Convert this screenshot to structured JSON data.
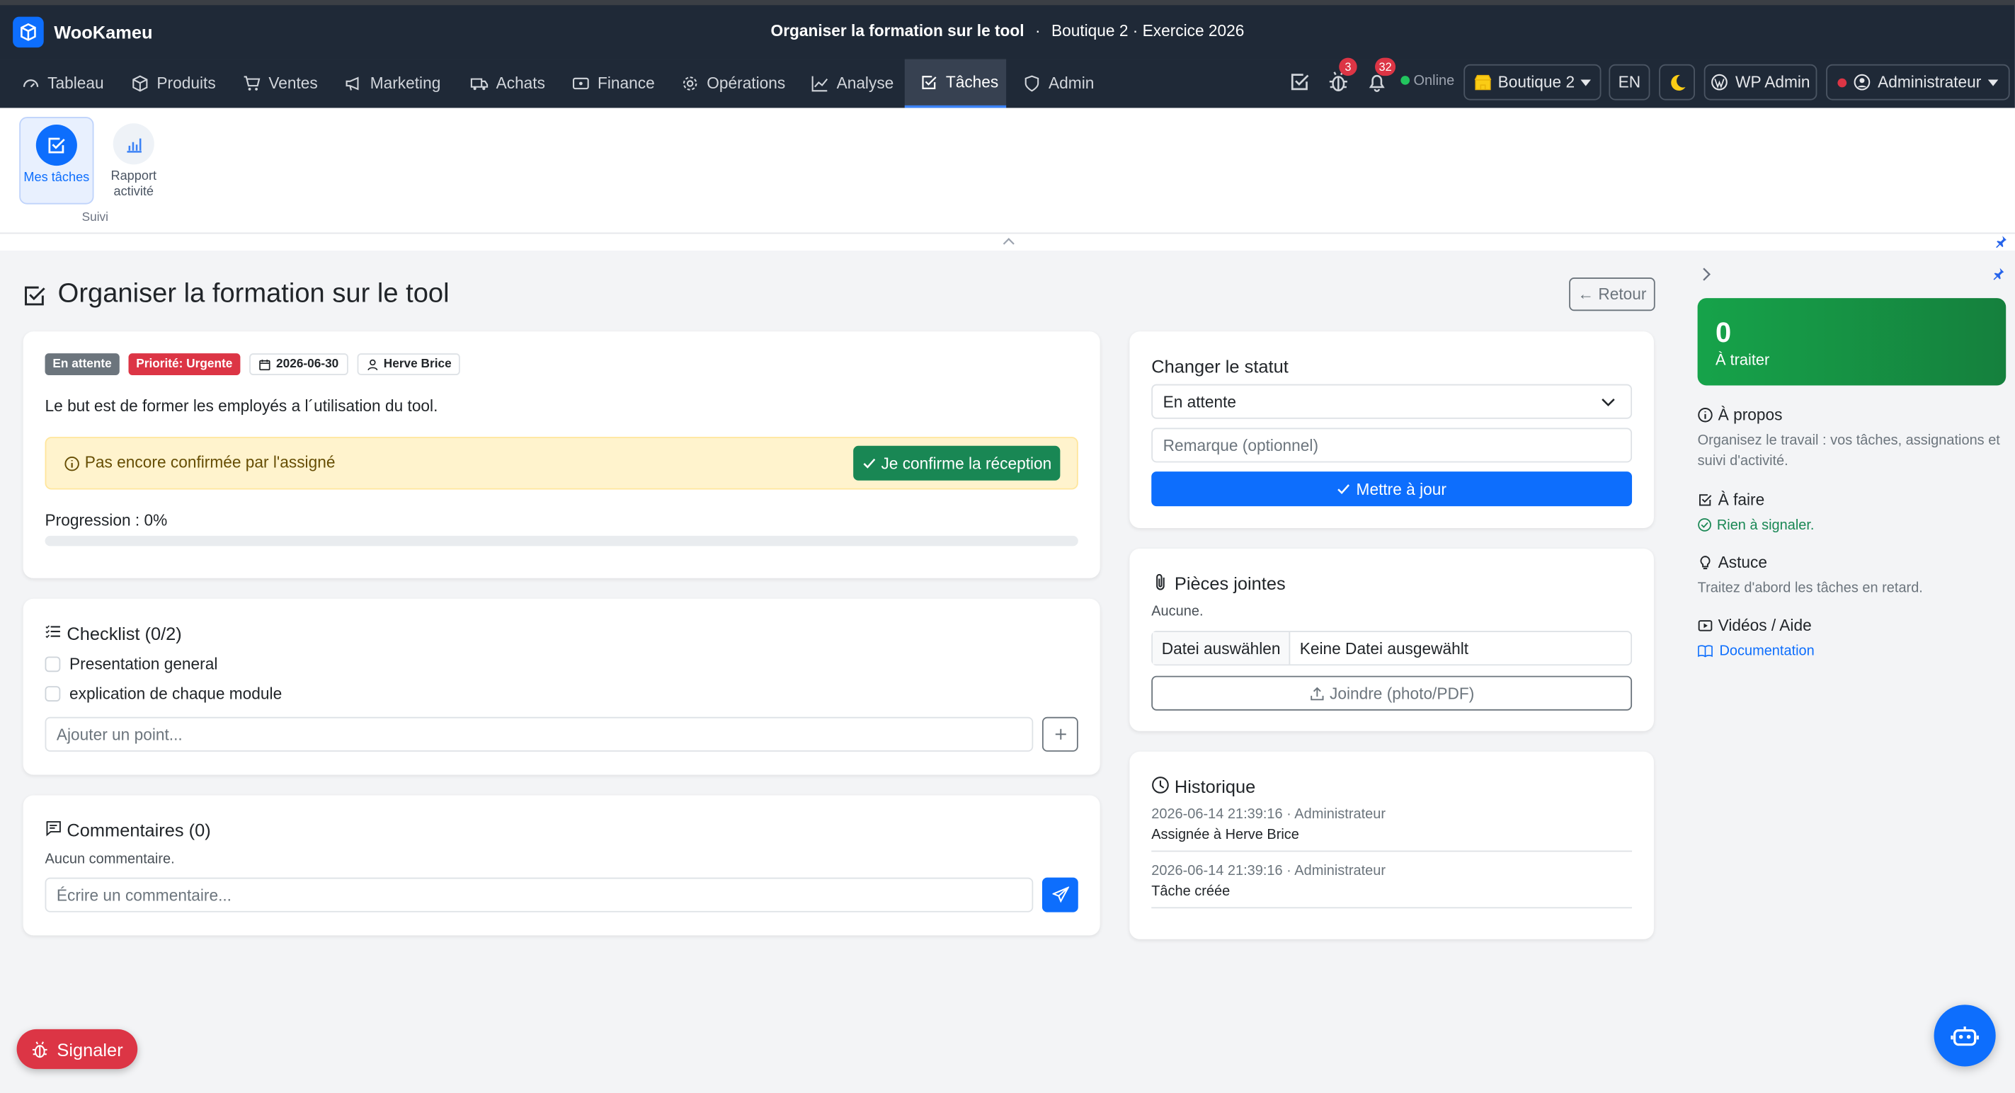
{
  "app": {
    "name": "WooKameu"
  },
  "context": {
    "task_title": "Organiser la formation sur le tool",
    "separator": "·",
    "shop_year": "Boutique 2 · Exercice 2026"
  },
  "nav": [
    {
      "label": "Tableau",
      "icon": "dashboard-icon"
    },
    {
      "label": "Produits",
      "icon": "box-icon"
    },
    {
      "label": "Ventes",
      "icon": "cart-icon"
    },
    {
      "label": "Marketing",
      "icon": "megaphone-icon"
    },
    {
      "label": "Achats",
      "icon": "truck-icon"
    },
    {
      "label": "Finance",
      "icon": "wallet-icon"
    },
    {
      "label": "Opérations",
      "icon": "gear-icon"
    },
    {
      "label": "Analyse",
      "icon": "chart-line-icon"
    },
    {
      "label": "Tâches",
      "icon": "check-square-icon",
      "active": true
    },
    {
      "label": "Admin",
      "icon": "shield-icon"
    }
  ],
  "nav_right": {
    "bug_count": "3",
    "notif_count": "32",
    "online": "Online",
    "shop": "Boutique 2",
    "lang": "EN",
    "wp_admin": "WP Admin",
    "user": "Administrateur"
  },
  "ribbon": {
    "tiles": [
      {
        "label": "Mes tâches"
      },
      {
        "label": "Rapport activité"
      }
    ],
    "group": "Suivi"
  },
  "page": {
    "title": "Organiser la formation sur le tool",
    "back": "← Retour"
  },
  "task": {
    "status_badge": "En attente",
    "priority_badge": "Priorité: Urgente",
    "due_date": "2026-06-30",
    "assignee": "Herve Brice",
    "description": "Le but est de former les employés a l´utilisation du tool.",
    "alert": "Pas encore confirmée par l'assigné",
    "confirm_button": "Je confirme la réception",
    "progress_label": "Progression : 0%",
    "progress": 0
  },
  "checklist": {
    "title": "Checklist (0/2)",
    "items": [
      "Presentation general",
      "explication de chaque module"
    ],
    "add_placeholder": "Ajouter un point..."
  },
  "comments": {
    "title": "Commentaires (0)",
    "empty": "Aucun commentaire.",
    "placeholder": "Écrire un commentaire..."
  },
  "status_panel": {
    "title": "Changer le statut",
    "selected": "En attente",
    "remark_placeholder": "Remarque (optionnel)",
    "update_button": "Mettre à jour"
  },
  "attachments": {
    "title": "Pièces jointes",
    "empty": "Aucune.",
    "file_button": "Datei auswählen",
    "file_status": "Keine Datei ausgewählt",
    "attach_button": "Joindre (photo/PDF)"
  },
  "history": {
    "title": "Historique",
    "entries": [
      {
        "meta": "2026-06-14 21:39:16 · Administrateur",
        "text": "Assignée à Herve Brice"
      },
      {
        "meta": "2026-06-14 21:39:16 · Administrateur",
        "text": "Tâche créée"
      }
    ]
  },
  "sidebar": {
    "kpi_value": "0",
    "kpi_label": "À traiter",
    "about_title": "À propos",
    "about_text": "Organisez le travail : vos tâches, assignations et suivi d'activité.",
    "todo_title": "À faire",
    "todo_text": "Rien à signaler.",
    "tip_title": "Astuce",
    "tip_text": "Traitez d'abord les tâches en retard.",
    "videos_title": "Vidéos / Aide",
    "doc_link": "Documentation"
  },
  "report_button": "Signaler",
  "colors": {
    "primary": "#0d6efd",
    "success": "#198754",
    "danger": "#dc3545",
    "warning_bg": "#fff3cd",
    "nav_bg": "#1f2937"
  }
}
